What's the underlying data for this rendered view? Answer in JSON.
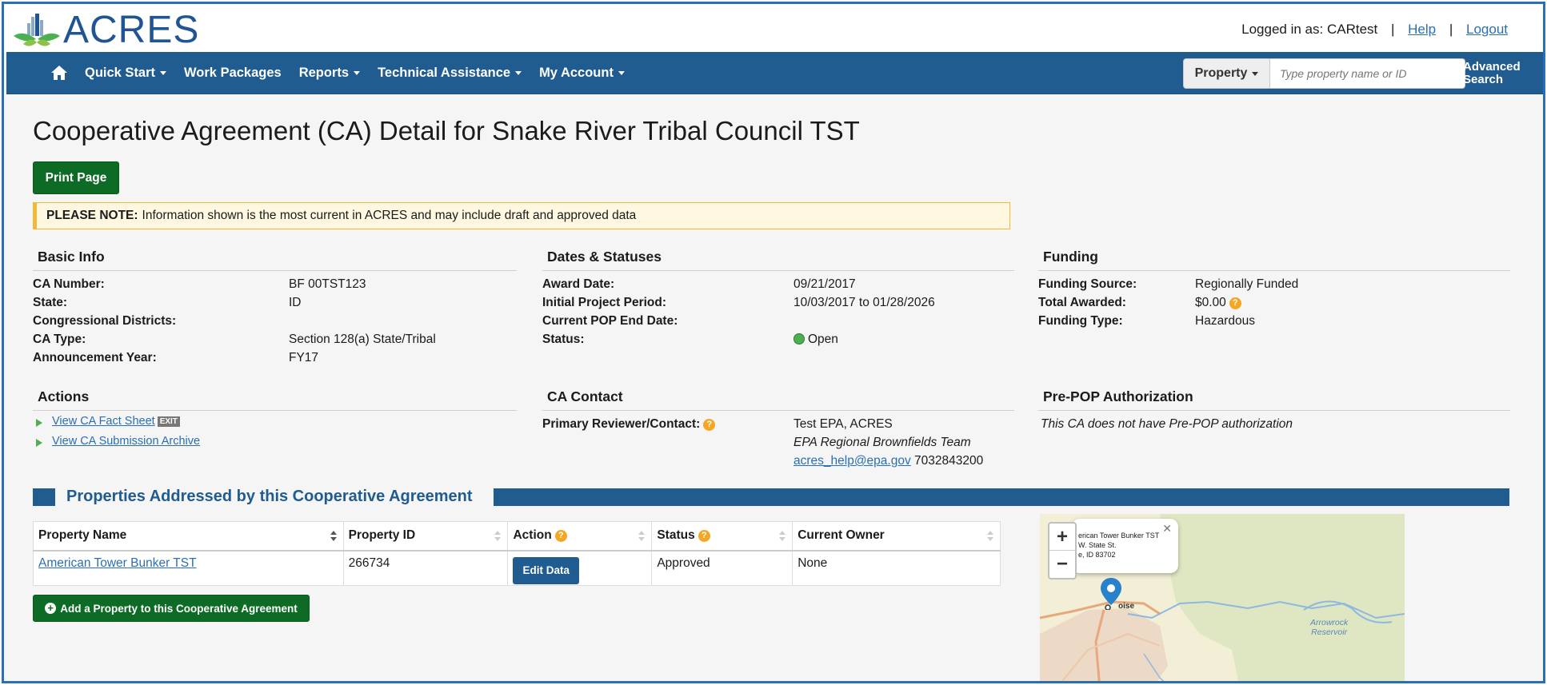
{
  "app": {
    "logo_text": "ACRES"
  },
  "user": {
    "logged_in_label": "Logged in as: CARtest",
    "help": "Help",
    "logout": "Logout"
  },
  "nav": {
    "items": [
      "Quick Start",
      "Work Packages",
      "Reports",
      "Technical Assistance",
      "My Account"
    ],
    "search_type": "Property",
    "search_placeholder": "Type property name or ID",
    "advanced_search_line1": "Advanced",
    "advanced_search_line2": "Search"
  },
  "page": {
    "title": "Cooperative Agreement (CA) Detail for Snake River Tribal Council TST",
    "print_button": "Print Page",
    "note_label": "PLEASE NOTE:",
    "note_text": "Information shown is the most current in ACRES and may include draft and approved data"
  },
  "basic_info": {
    "heading": "Basic Info",
    "rows": [
      {
        "label": "CA Number:",
        "value": "BF 00TST123"
      },
      {
        "label": "State:",
        "value": "ID"
      },
      {
        "label": "Congressional Districts:",
        "value": ""
      },
      {
        "label": "CA Type:",
        "value": "Section 128(a) State/Tribal"
      },
      {
        "label": "Announcement Year:",
        "value": "FY17"
      }
    ]
  },
  "dates": {
    "heading": "Dates & Statuses",
    "rows": [
      {
        "label": "Award Date:",
        "value": "09/21/2017"
      },
      {
        "label": "Initial Project Period:",
        "value": "10/03/2017 to 01/28/2026"
      },
      {
        "label": "Current POP End Date:",
        "value": ""
      },
      {
        "label": "Status:",
        "value": "Open"
      }
    ]
  },
  "funding": {
    "heading": "Funding",
    "rows": [
      {
        "label": "Funding Source:",
        "value": "Regionally Funded"
      },
      {
        "label": "Total Awarded:",
        "value": "$0.00"
      },
      {
        "label": "Funding Type:",
        "value": "Hazardous"
      }
    ]
  },
  "actions": {
    "heading": "Actions",
    "links": [
      "View CA Fact Sheet",
      "View CA Submission Archive"
    ],
    "exit_badge": "EXIT"
  },
  "contact": {
    "heading": "CA Contact",
    "label": "Primary Reviewer/Contact:",
    "name": "Test EPA, ACRES",
    "team": "EPA Regional Brownfields Team",
    "email": "acres_help@epa.gov",
    "phone": "7032843200"
  },
  "prepop": {
    "heading": "Pre-POP Authorization",
    "text": "This CA does not have Pre-POP authorization"
  },
  "properties": {
    "heading": "Properties Addressed by this Cooperative Agreement",
    "columns": [
      "Property Name",
      "Property ID",
      "Action",
      "Status",
      "Current Owner"
    ],
    "rows": [
      {
        "name": "American Tower Bunker TST",
        "id": "266734",
        "action": "Edit Data",
        "status": "Approved",
        "owner": "None"
      }
    ],
    "add_button": "Add a Property to this Cooperative Agreement"
  },
  "map": {
    "popup_line1": "erican Tower Bunker TST",
    "popup_line2": "W. State St.",
    "popup_line3": "e, ID 83702",
    "city_label": "oise",
    "reservoir_label_1": "Arrowrock",
    "reservoir_label_2": "Reservoir",
    "zoom_in": "+",
    "zoom_out": "−"
  },
  "colors": {
    "nav_blue": "#205c8f",
    "link_blue": "#2a6fb3",
    "green_button": "#0e6b26",
    "help_orange": "#f5a623",
    "status_open": "#4caf50"
  }
}
